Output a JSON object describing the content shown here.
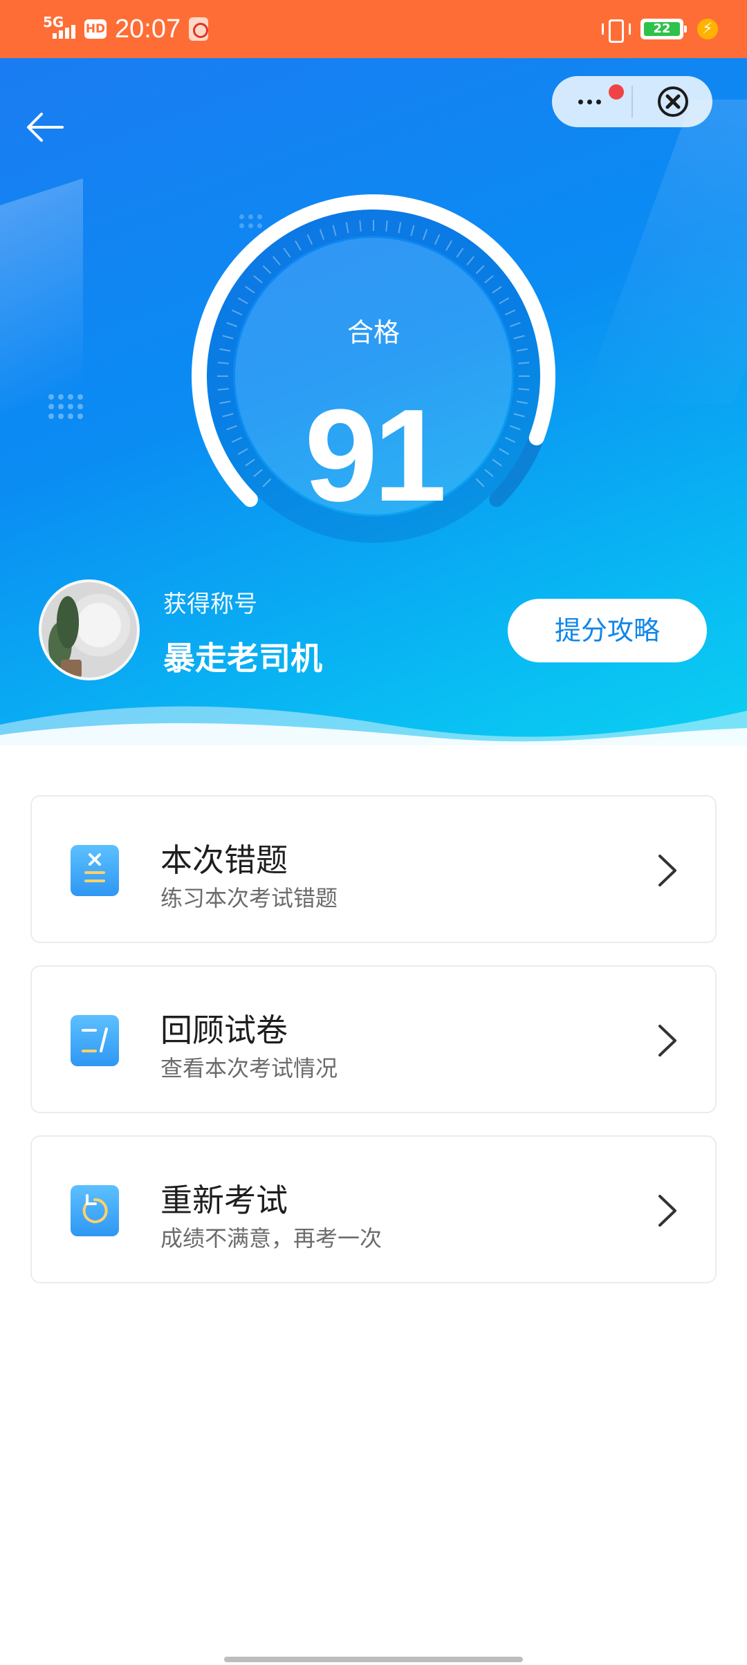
{
  "status_bar": {
    "network": "5G",
    "hd_label": "HD",
    "time": "20:07",
    "battery_level": "22"
  },
  "hero": {
    "result_label": "合格",
    "score": "91",
    "score_fraction": 0.91,
    "title_caption": "获得称号",
    "title_name": "暴走老司机",
    "tips_button": "提分攻略"
  },
  "cards": [
    {
      "title": "本次错题",
      "subtitle": "练习本次考试错题",
      "icon": "wrong-answers-icon"
    },
    {
      "title": "回顾试卷",
      "subtitle": "查看本次考试情况",
      "icon": "review-paper-icon"
    },
    {
      "title": "重新考试",
      "subtitle": "成绩不满意，再考一次",
      "icon": "retake-icon"
    }
  ],
  "colors": {
    "status_bar": "#ff6d36",
    "hero_start": "#1a7cf2",
    "hero_end": "#0ad0f2",
    "accent": "#0f86ea",
    "icon_yellow": "#ffd26a"
  }
}
